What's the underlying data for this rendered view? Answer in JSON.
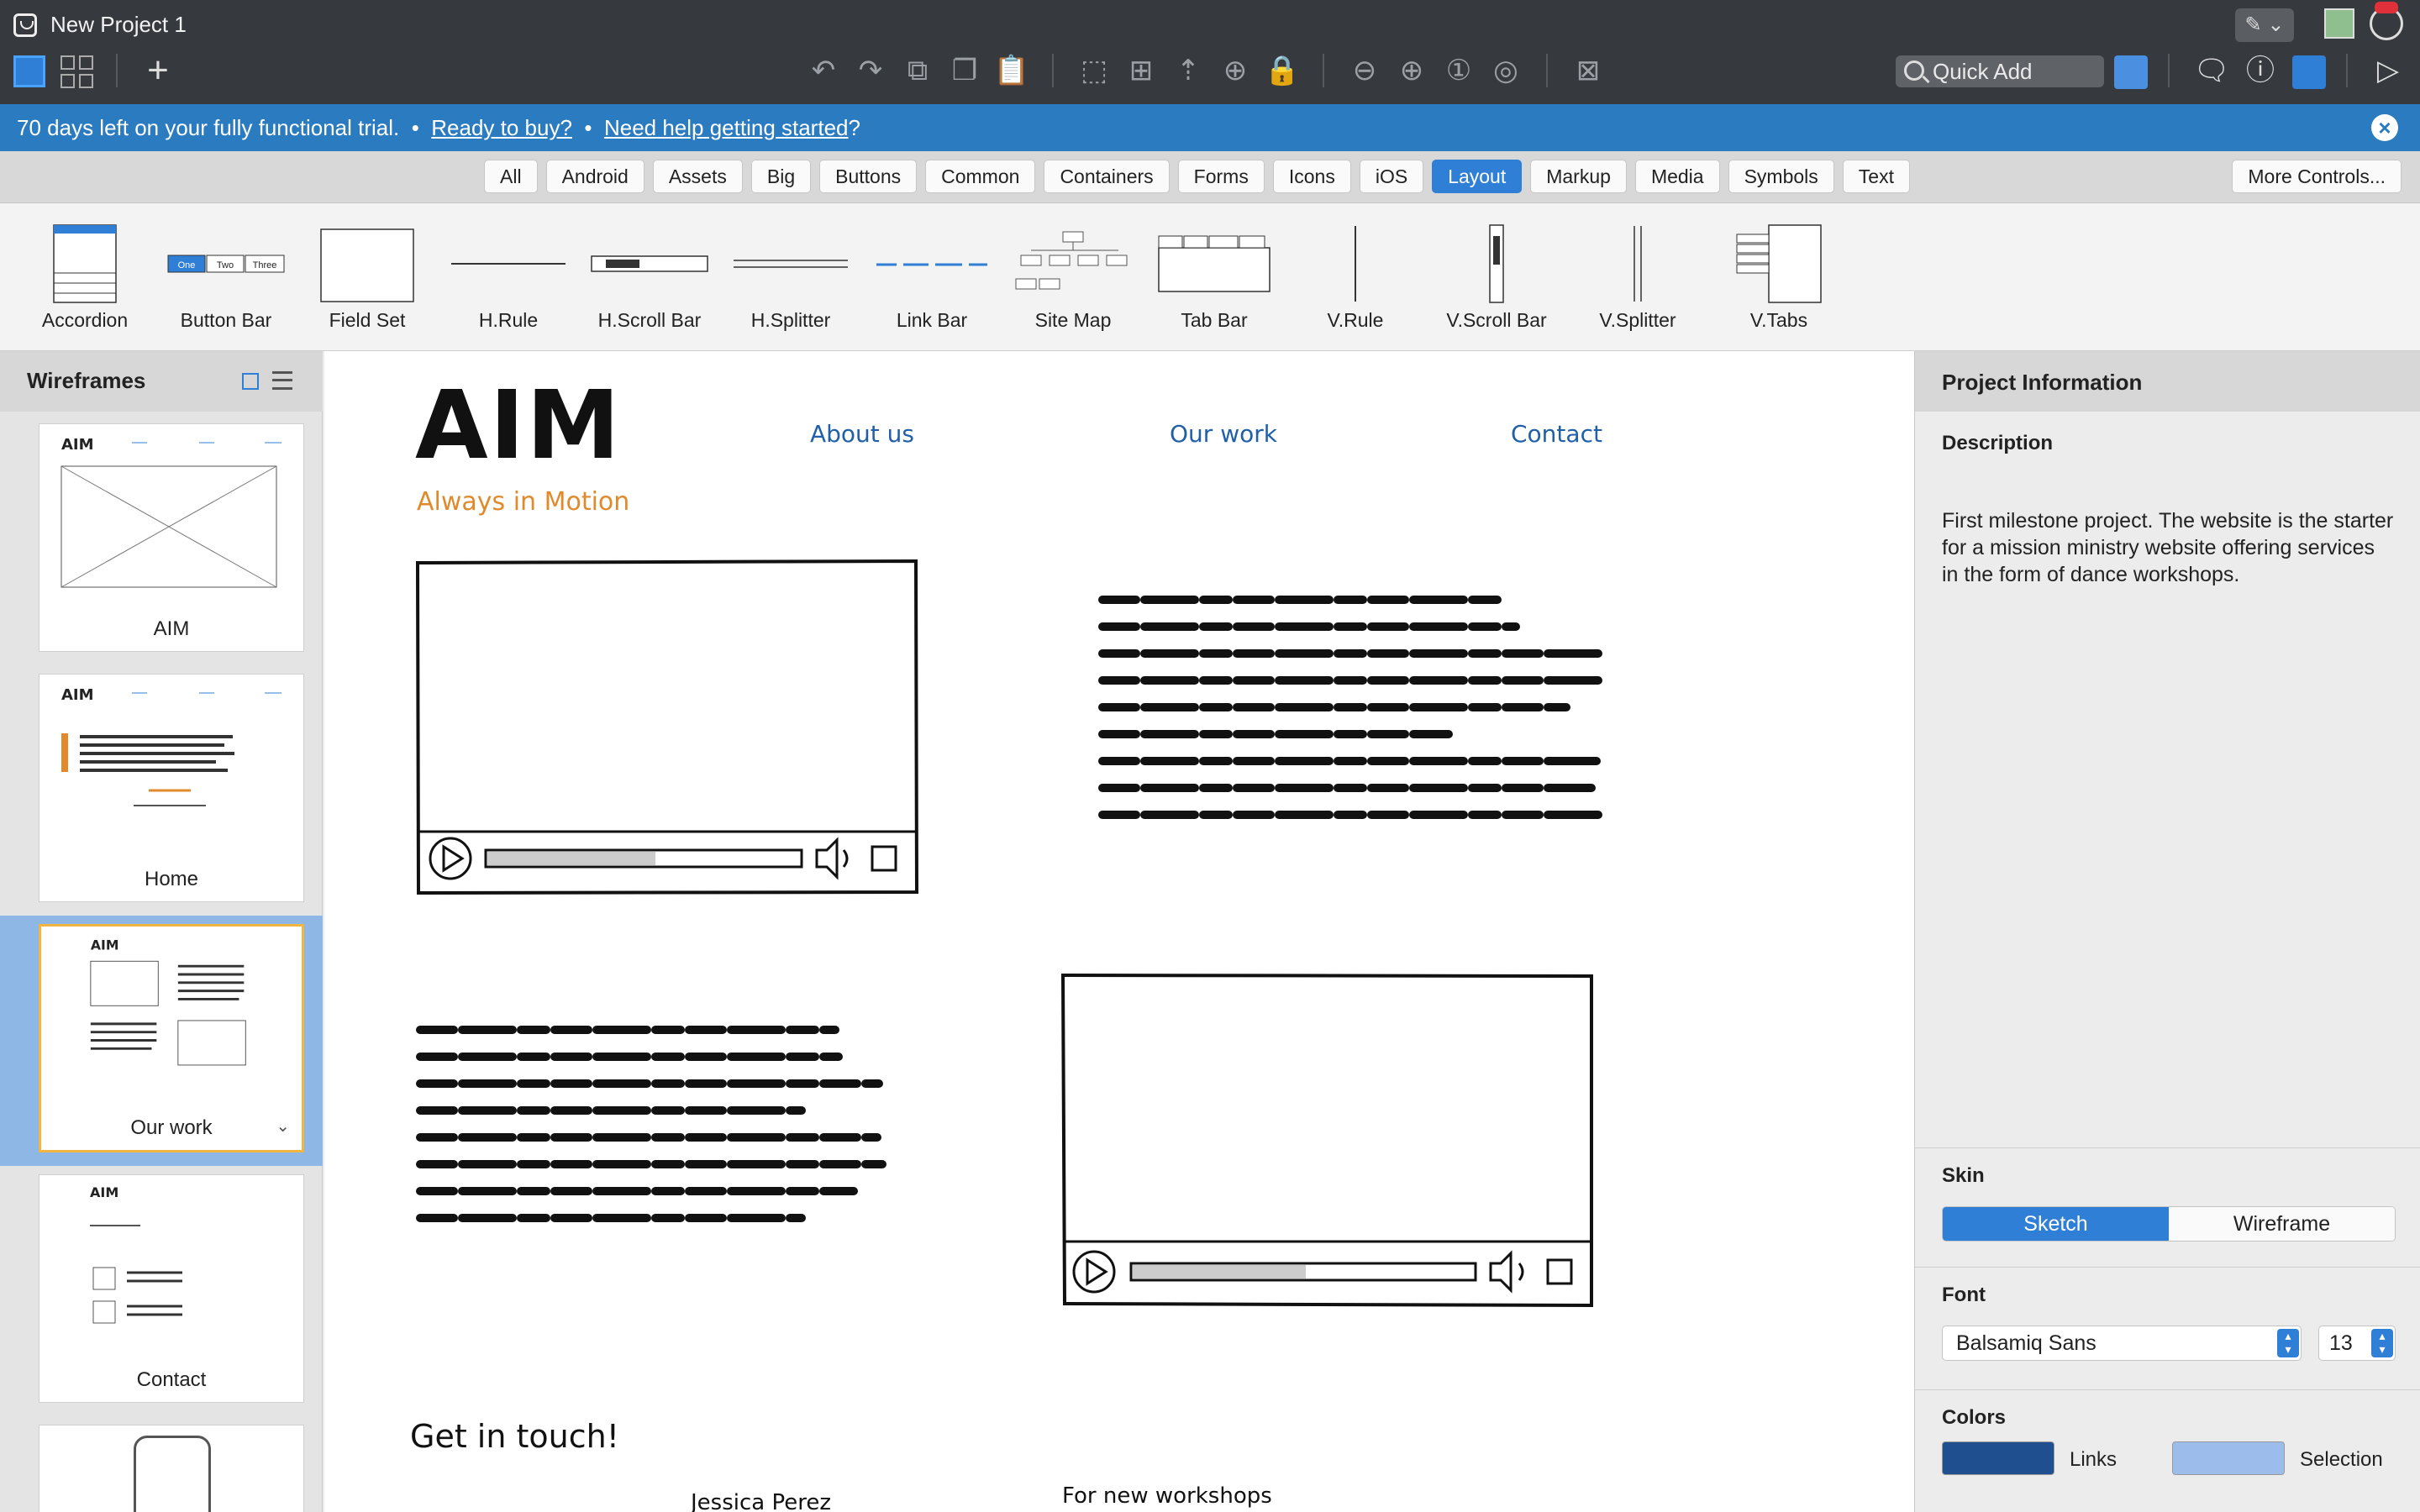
{
  "window": {
    "title": "New Project 1"
  },
  "toolbar": {
    "quick_add_placeholder": "Quick Add"
  },
  "trial": {
    "message": "70 days left on your fully functional trial.",
    "sep1": "•",
    "buy_link": "Ready to buy?",
    "sep2": "•",
    "help_link": "Need help getting started",
    "help_suffix": "?"
  },
  "filters": {
    "items": [
      "All",
      "Android",
      "Assets",
      "Big",
      "Buttons",
      "Common",
      "Containers",
      "Forms",
      "Icons",
      "iOS",
      "Layout",
      "Markup",
      "Media",
      "Symbols",
      "Text"
    ],
    "active": "Layout",
    "more": "More Controls..."
  },
  "library": {
    "items": [
      "Accordion",
      "Button Bar",
      "Field Set",
      "H.Rule",
      "H.Scroll Bar",
      "H.Splitter",
      "Link Bar",
      "Site Map",
      "Tab Bar",
      "V.Rule",
      "V.Scroll Bar",
      "V.Splitter",
      "V.Tabs"
    ],
    "button_bar_labels": [
      "One",
      "Two",
      "Three"
    ]
  },
  "left_panel": {
    "title": "Wireframes",
    "pages": [
      "AIM",
      "Home",
      "Our work",
      "Contact"
    ],
    "selected": "Our work"
  },
  "canvas": {
    "logo": "AIM",
    "tagline": "Always in Motion",
    "nav": [
      "About us",
      "Our work",
      "Contact"
    ],
    "get_in_touch": "Get in touch!",
    "name_partial": "Jessica Perez",
    "for_new": "For new workshops"
  },
  "right_panel": {
    "title": "Project Information",
    "description_label": "Description",
    "description": "First milestone project. The website is the starter for a mission ministry website offering services in the form of dance workshops.",
    "skin_label": "Skin",
    "skin_options": [
      "Sketch",
      "Wireframe"
    ],
    "skin_selected": "Sketch",
    "font_label": "Font",
    "font_name": "Balsamiq Sans",
    "font_size": "13",
    "colors_label": "Colors",
    "links_label": "Links",
    "selection_label": "Selection",
    "link_color": "#1f4f8f",
    "selection_color": "#9cbcec"
  },
  "colors": {
    "accent": "#2f7fd6",
    "trial_bar": "#2b7bc0",
    "tagline": "#e08a2c"
  }
}
